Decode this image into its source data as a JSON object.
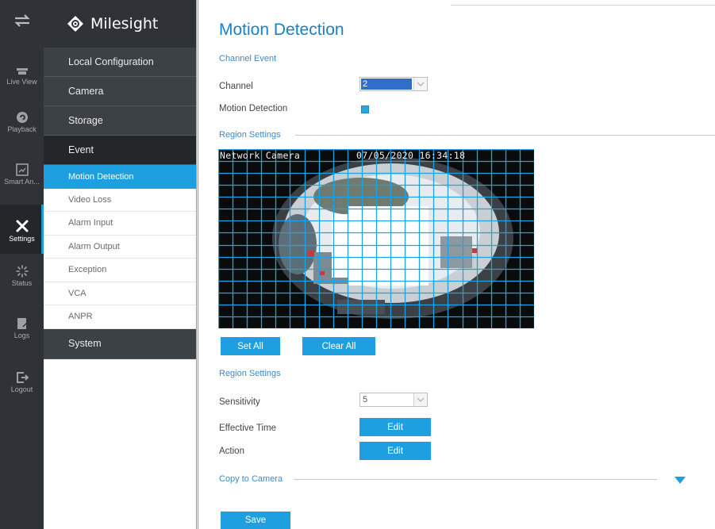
{
  "rail": {
    "items": [
      {
        "name": "rail-item-toggle",
        "label": "",
        "icon": "swap-arrows-icon"
      },
      {
        "name": "rail-item-live-view",
        "label": "Live View",
        "icon": "live-view-icon"
      },
      {
        "name": "rail-item-playback",
        "label": "Playback",
        "icon": "playback-icon"
      },
      {
        "name": "rail-item-smart-analysis",
        "label": "Smart An...",
        "icon": "smart-analysis-icon"
      },
      {
        "name": "rail-item-settings",
        "label": "Settings",
        "icon": "settings-tools-icon"
      },
      {
        "name": "rail-item-status",
        "label": "Status",
        "icon": "status-spinner-icon"
      },
      {
        "name": "rail-item-logs",
        "label": "Logs",
        "icon": "logs-icon"
      },
      {
        "name": "rail-item-logout",
        "label": "Logout",
        "icon": "logout-icon"
      }
    ]
  },
  "brand": {
    "name": "Milesight",
    "icon": "milesight-logo-icon"
  },
  "menu": {
    "local_configuration": "Local Configuration",
    "camera": "Camera",
    "storage": "Storage",
    "event": "Event",
    "system": "System",
    "event_items": [
      "Motion Detection",
      "Video Loss",
      "Alarm Input",
      "Alarm Output",
      "Exception",
      "VCA",
      "ANPR"
    ]
  },
  "main": {
    "title": "Motion Detection",
    "channel_event": "Channel Event",
    "channel_label": "Channel",
    "channel_value": "2",
    "motion_detection_label": "Motion Detection",
    "motion_detection_checked": true,
    "region_settings": "Region Settings",
    "osd_name": "Network Camera",
    "osd_time": "07/05/2020 16:34:18",
    "set_all": "Set All",
    "clear_all": "Clear All",
    "region_settings_2": "Region Settings",
    "sensitivity_label": "Sensitivity",
    "sensitivity_value": "5",
    "effective_time_label": "Effective Time",
    "effective_time_button": "Edit",
    "action_label": "Action",
    "action_button": "Edit",
    "copy_to_camera": "Copy to Camera",
    "save": "Save"
  },
  "colors": {
    "accent": "#1e9fe0",
    "title": "#1a7fc4",
    "rail_bg": "#2f3337",
    "grid_line": "#1aa3e8"
  }
}
